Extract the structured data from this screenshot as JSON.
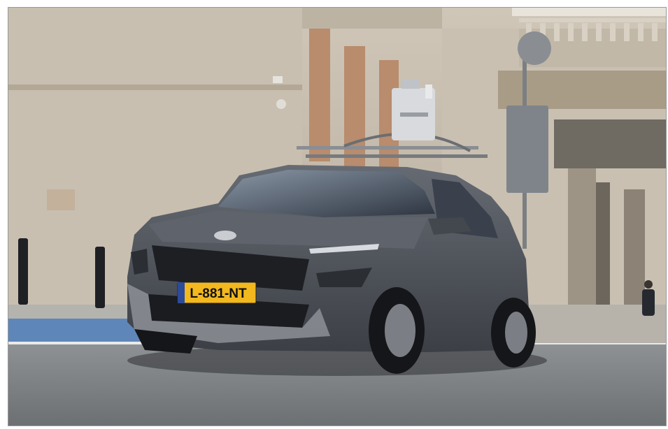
{
  "image": {
    "plate_text": "L-881-NT",
    "plate_color": "#f2b81e",
    "car_color": "#4f535a"
  }
}
